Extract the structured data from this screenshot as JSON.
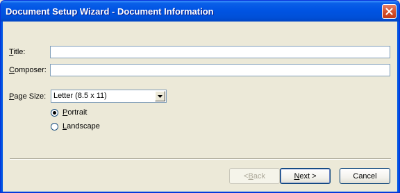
{
  "window": {
    "title": "Document Setup Wizard - Document Information"
  },
  "form": {
    "title_label_accel": "T",
    "title_label_rest": "itle:",
    "title_value": "",
    "composer_label_accel": "C",
    "composer_label_rest": "omposer:",
    "composer_value": "",
    "page_size_label_accel": "P",
    "page_size_label_rest": "age Size:",
    "page_size_value": "Letter (8.5 x 11)",
    "orientation": {
      "portrait_accel": "P",
      "portrait_rest": "ortrait",
      "landscape_accel": "L",
      "landscape_rest": "andscape",
      "selected": "Portrait"
    }
  },
  "buttons": {
    "back_label_prefix": "< ",
    "back_label_accel": "B",
    "back_label_rest": "ack",
    "next_label_accel": "N",
    "next_label_rest": "ext >",
    "cancel_label": "Cancel"
  }
}
